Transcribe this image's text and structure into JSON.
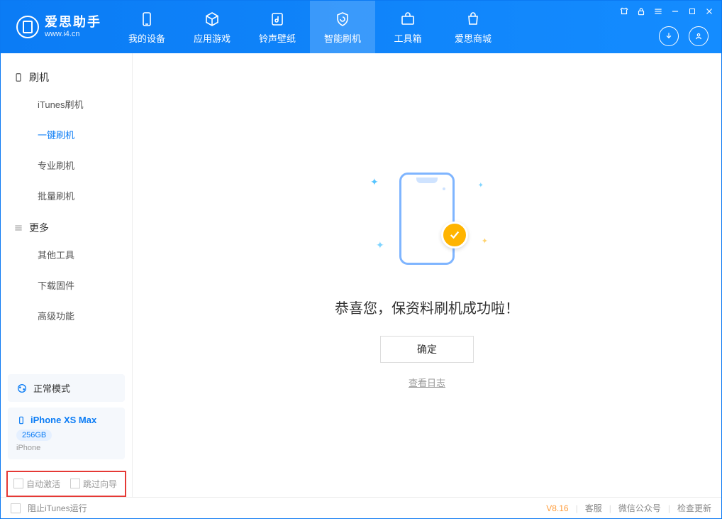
{
  "app": {
    "title": "爱思助手",
    "subtitle": "www.i4.cn"
  },
  "tabs": {
    "device": "我的设备",
    "apps": "应用游戏",
    "ringtone": "铃声壁纸",
    "flash": "智能刷机",
    "toolbox": "工具箱",
    "store": "爱思商城"
  },
  "sidebar": {
    "group_flash": "刷机",
    "items_flash": {
      "itunes": "iTunes刷机",
      "oneclick": "一键刷机",
      "pro": "专业刷机",
      "batch": "批量刷机"
    },
    "group_more": "更多",
    "items_more": {
      "other": "其他工具",
      "firmware": "下载固件",
      "advanced": "高级功能"
    },
    "mode": "正常模式",
    "device_name": "iPhone XS Max",
    "device_storage": "256GB",
    "device_type": "iPhone",
    "chk_activate": "自动激活",
    "chk_skip": "跳过向导"
  },
  "main": {
    "message": "恭喜您，保资料刷机成功啦！",
    "ok": "确定",
    "view_log": "查看日志"
  },
  "footer": {
    "block_itunes": "阻止iTunes运行",
    "version": "V8.16",
    "support": "客服",
    "wechat": "微信公众号",
    "update": "检查更新"
  }
}
